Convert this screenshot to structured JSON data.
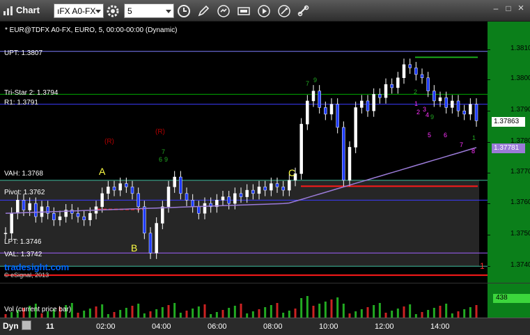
{
  "window": {
    "title": "Chart",
    "symbol_combo": "ıFX A0-FX",
    "interval_combo": "5",
    "controls": {
      "minimize": "‒",
      "restore": "□",
      "close": "×"
    }
  },
  "toolbar_icons": [
    "gear-icon",
    "clock-icon",
    "pencil-icon",
    "refresh-icon",
    "quote-icon",
    "play-icon",
    "settings-icon",
    "link-icon"
  ],
  "chart": {
    "header": "* EUR@TDFX A0-FX, EURO, 5, 00:00-00:00 (Dynamic)",
    "levels": [
      {
        "label": "UPT: 1.3807",
        "price": 1.3807,
        "color": "#7f7fff"
      },
      {
        "label": "Tri-Star 2: 1.3794",
        "price": 1.3794,
        "color": "#00aa00"
      },
      {
        "label": "R1: 1.3791",
        "price": 1.3791,
        "color": "#3b3bff"
      },
      {
        "label": "VAH: 1.3768",
        "price": 1.3768,
        "color": "#40c0a0"
      },
      {
        "label": "Pivot: 1.3762",
        "price": 1.3762,
        "color": "#3b3bff"
      },
      {
        "label": "LPT: 1.3746",
        "price": 1.3746,
        "color": "#a060ff"
      },
      {
        "label": "VAL: 1.3742",
        "price": 1.3742,
        "color": "#40c0a0"
      }
    ],
    "price_ticks": [
      "1.38100",
      "1.38000",
      "1.37900",
      "1.37800",
      "1.37700",
      "1.37600",
      "1.37500",
      "1.37400"
    ],
    "last_price": "1.37863",
    "vwap_price": "1.37781",
    "red_line_price_tag": "1",
    "watermark": "tradesight.com",
    "copyright": "© eSignal, 2013",
    "annotations": [
      "A",
      "B",
      "C"
    ],
    "r_marks": [
      "(R)",
      "(R)"
    ],
    "seq_pink": [
      "1",
      "2",
      "3",
      "4",
      "5",
      "6",
      "7",
      "8"
    ],
    "seq_green": [
      "1",
      "2",
      "3",
      "4",
      "5",
      "6",
      "7",
      "8",
      "9"
    ]
  },
  "volume": {
    "label": "Vol (current price bar)",
    "value": "438"
  },
  "time_axis": {
    "dyn_label": "Dyn",
    "day_label": "11",
    "labels": [
      "02:00",
      "04:00",
      "06:00",
      "08:00",
      "10:00",
      "12:00",
      "14:00"
    ]
  },
  "chart_data": {
    "type": "candlestick",
    "title": "* EUR@TDFX A0-FX, EURO, 5, 00:00-00:00 (Dynamic)",
    "ylim": [
      1.3737,
      1.3816
    ],
    "y_ticks": [
      1.381,
      1.38,
      1.379,
      1.378,
      1.377,
      1.376,
      1.375,
      1.374
    ],
    "x_labels": [
      "02:00",
      "04:00",
      "06:00",
      "08:00",
      "10:00",
      "12:00",
      "14:00"
    ],
    "close_series": [
      1.3752,
      1.3758,
      1.3762,
      1.3759,
      1.3761,
      1.3757,
      1.376,
      1.3758,
      1.3756,
      1.3757,
      1.3759,
      1.3758,
      1.3757,
      1.3756,
      1.3758,
      1.376,
      1.3764,
      1.3766,
      1.3765,
      1.3767,
      1.3766,
      1.3764,
      1.376,
      1.3752,
      1.3746,
      1.3755,
      1.376,
      1.3766,
      1.3769,
      1.3764,
      1.3762,
      1.376,
      1.3758,
      1.3761,
      1.376,
      1.3762,
      1.3763,
      1.3761,
      1.3764,
      1.3763,
      1.3765,
      1.3764,
      1.3766,
      1.3765,
      1.3767,
      1.3766,
      1.3765,
      1.3768,
      1.377,
      1.3785,
      1.3792,
      1.3795,
      1.379,
      1.3788,
      1.3791,
      1.3784,
      1.3768,
      1.3778,
      1.379,
      1.3792,
      1.3789,
      1.3794,
      1.3793,
      1.3797,
      1.3796,
      1.3799,
      1.3803,
      1.3802,
      1.38,
      1.3799,
      1.3795,
      1.3792,
      1.3793,
      1.379,
      1.3792,
      1.3789,
      1.3788,
      1.3791,
      1.3786
    ],
    "vwap": {
      "start": 1.3758,
      "end": 1.37781
    }
  }
}
